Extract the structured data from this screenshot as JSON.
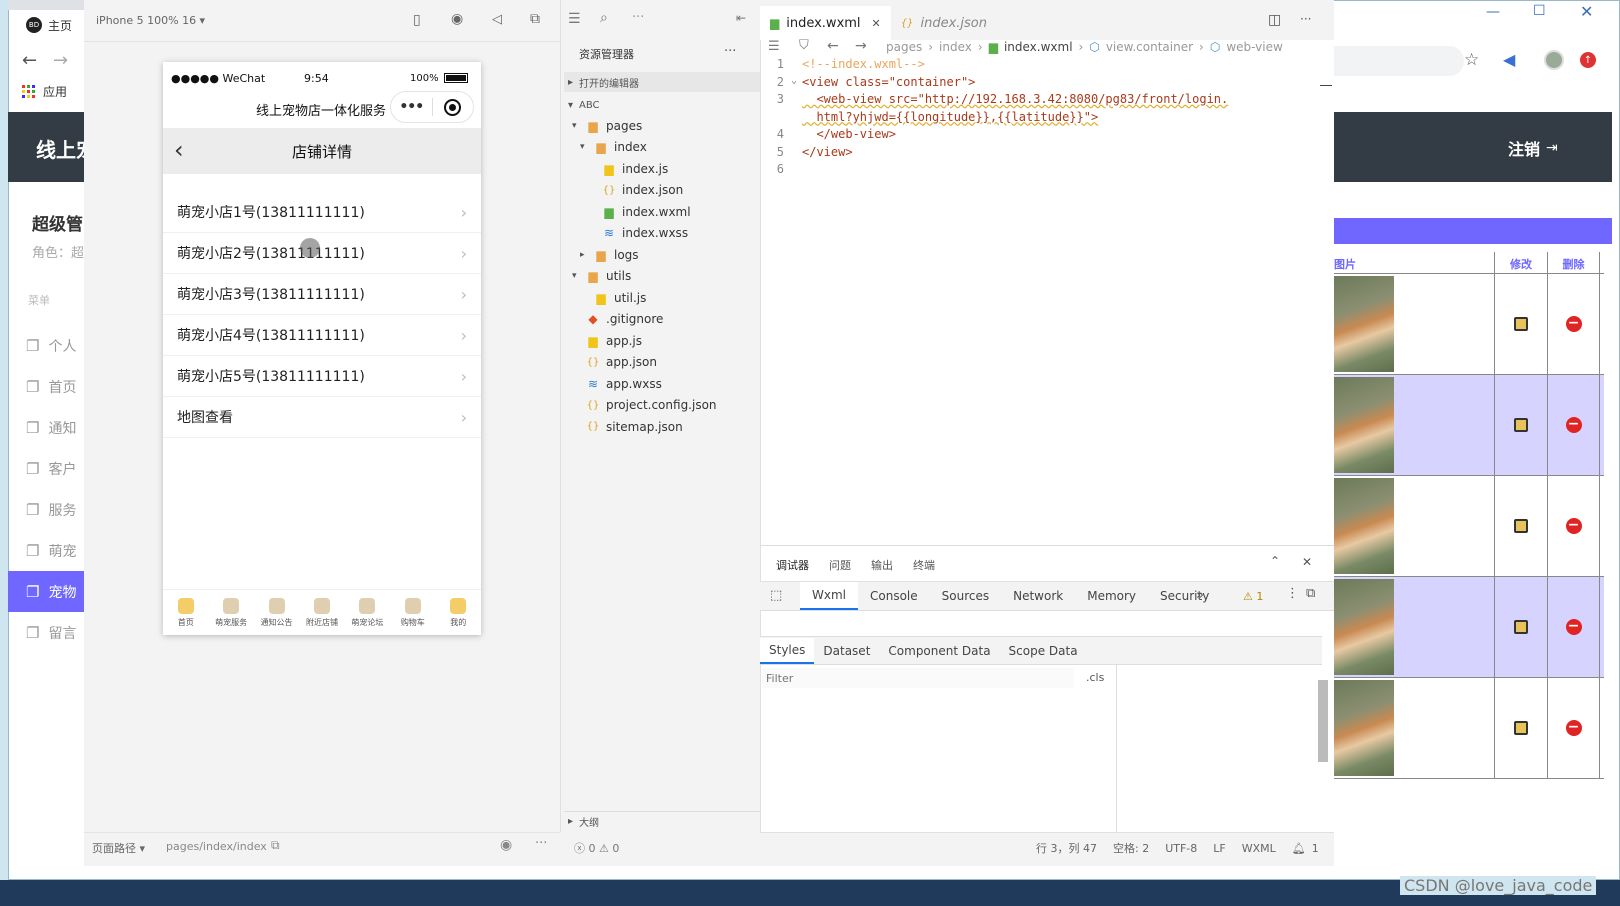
{
  "browser": {
    "tab_title": "主页",
    "tab_favicon_text": "BD",
    "apps_label": "应用"
  },
  "webpage": {
    "logo_partial": "线上宠",
    "logout_label": "注销",
    "admin_title_partial": "超级管",
    "role_partial": "角色：超",
    "menu_heading": "菜单",
    "sidebar_items": [
      "个人",
      "首页",
      "通知",
      "客户",
      "服务",
      "萌宠",
      "宠物",
      "留言"
    ],
    "active_index": 6,
    "table_headers": {
      "image_partial": "图片",
      "edit": "修改",
      "delete": "删除"
    },
    "row_count": 5,
    "accent": "#6f67ff",
    "row_highlight": "#d7d3ff"
  },
  "simulator": {
    "device_label": "iPhone 5 100% 16 ▾",
    "status_carrier": "●●●●● WeChat",
    "status_time": "9:54",
    "status_battery": "100%",
    "mp_title": "线上宠物店一体化服务",
    "page_title": "店铺详情",
    "list": [
      "萌宠小店1号(13811111111)",
      "萌宠小店2号(13811111111)",
      "萌宠小店3号(13811111111)",
      "萌宠小店4号(13811111111)",
      "萌宠小店5号(13811111111)",
      "地图查看"
    ],
    "tabs": [
      "首页",
      "萌宠服务",
      "通知公告",
      "附近店铺",
      "萌宠论坛",
      "购物车",
      "我的"
    ],
    "footer_path_label": "页面路径 ▾",
    "footer_path": "pages/index/index"
  },
  "explorer": {
    "title": "资源管理器",
    "open_editors": "打开的编辑器",
    "project": "ABC",
    "tree": [
      {
        "label": "pages",
        "depth": 1,
        "kind": "folder",
        "open": true
      },
      {
        "label": "index",
        "depth": 2,
        "kind": "folder",
        "open": true
      },
      {
        "label": "index.js",
        "depth": 3,
        "kind": "js"
      },
      {
        "label": "index.json",
        "depth": 3,
        "kind": "json"
      },
      {
        "label": "index.wxml",
        "depth": 3,
        "kind": "wxml"
      },
      {
        "label": "index.wxss",
        "depth": 3,
        "kind": "wxss"
      },
      {
        "label": "logs",
        "depth": 2,
        "kind": "folder",
        "open": false
      },
      {
        "label": "utils",
        "depth": 1,
        "kind": "folder",
        "open": true
      },
      {
        "label": "util.js",
        "depth": 2,
        "kind": "js"
      },
      {
        "label": ".gitignore",
        "depth": 1,
        "kind": "git"
      },
      {
        "label": "app.js",
        "depth": 1,
        "kind": "js"
      },
      {
        "label": "app.json",
        "depth": 1,
        "kind": "json"
      },
      {
        "label": "app.wxss",
        "depth": 1,
        "kind": "wxss"
      },
      {
        "label": "project.config.json",
        "depth": 1,
        "kind": "json"
      },
      {
        "label": "sitemap.json",
        "depth": 1,
        "kind": "json"
      }
    ],
    "outline": "大纲",
    "status_errors": "ⓧ 0 ⚠ 0"
  },
  "editor": {
    "tabs": [
      {
        "label": "index.wxml",
        "active": true
      },
      {
        "label": "index.json",
        "active": false
      }
    ],
    "breadcrumb": [
      "pages",
      "index",
      "index.wxml",
      "view.container",
      "web-view"
    ],
    "lines": [
      {
        "n": "1",
        "text": "<!--index.wxml-->"
      },
      {
        "n": "2",
        "text": "<view class=\"container\">"
      },
      {
        "n": "3",
        "text": "  <web-view src=\"http://192.168.3.42:8080/pg83/front/login."
      },
      {
        "n": "",
        "text": "  html?yhjwd={{longitude}},{{latitude}}\">"
      },
      {
        "n": "4",
        "text": "  </web-view>"
      },
      {
        "n": "5",
        "text": "</view>"
      },
      {
        "n": "6",
        "text": ""
      }
    ]
  },
  "devtools": {
    "top_tabs": [
      "调试器",
      "问题",
      "输出",
      "终端"
    ],
    "tabs": [
      "Wxml",
      "Console",
      "Sources",
      "Network",
      "Memory",
      "Security"
    ],
    "more": "»",
    "warnings": "⚠ 1",
    "sub_tabs": [
      "Styles",
      "Dataset",
      "Component Data",
      "Scope Data"
    ],
    "filter_placeholder": "Filter",
    "cls": ".cls"
  },
  "statusbar": {
    "position": "行 3，列 47",
    "spaces": "空格: 2",
    "encoding": "UTF-8",
    "eol": "LF",
    "lang": "WXML",
    "bell": "1"
  },
  "watermark": "CSDN @love_java_code"
}
